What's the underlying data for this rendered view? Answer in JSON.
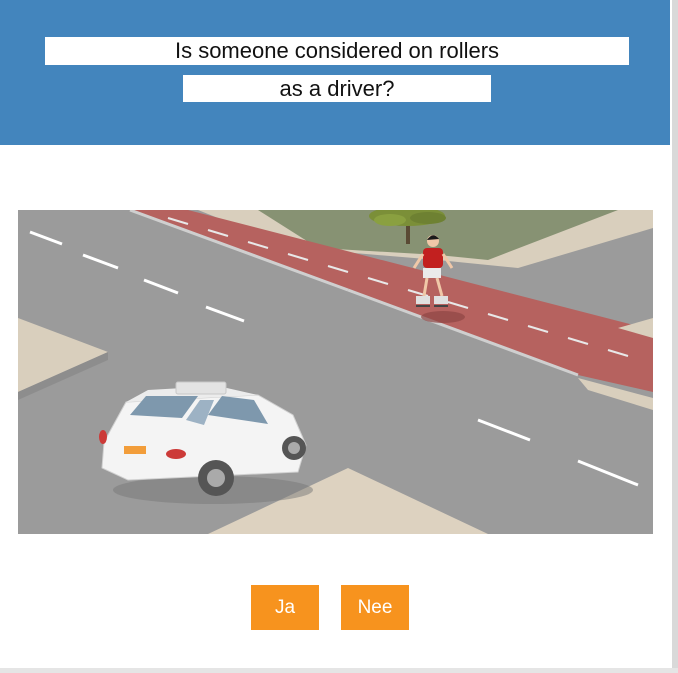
{
  "question": {
    "line1": "Is someone considered on rollers",
    "line2": "as a driver?"
  },
  "scene": {
    "icon_names": [
      "road-intersection",
      "car-icon",
      "inline-skater-icon",
      "tree-icon",
      "bike-lane"
    ]
  },
  "answers": {
    "yes_label": "Ja",
    "no_label": "Nee"
  },
  "colors": {
    "header": "#4385bd",
    "button": "#f7931e",
    "bike_lane": "#b5625f",
    "road": "#9a9a9a",
    "sidewalk": "#ddd2c0"
  }
}
